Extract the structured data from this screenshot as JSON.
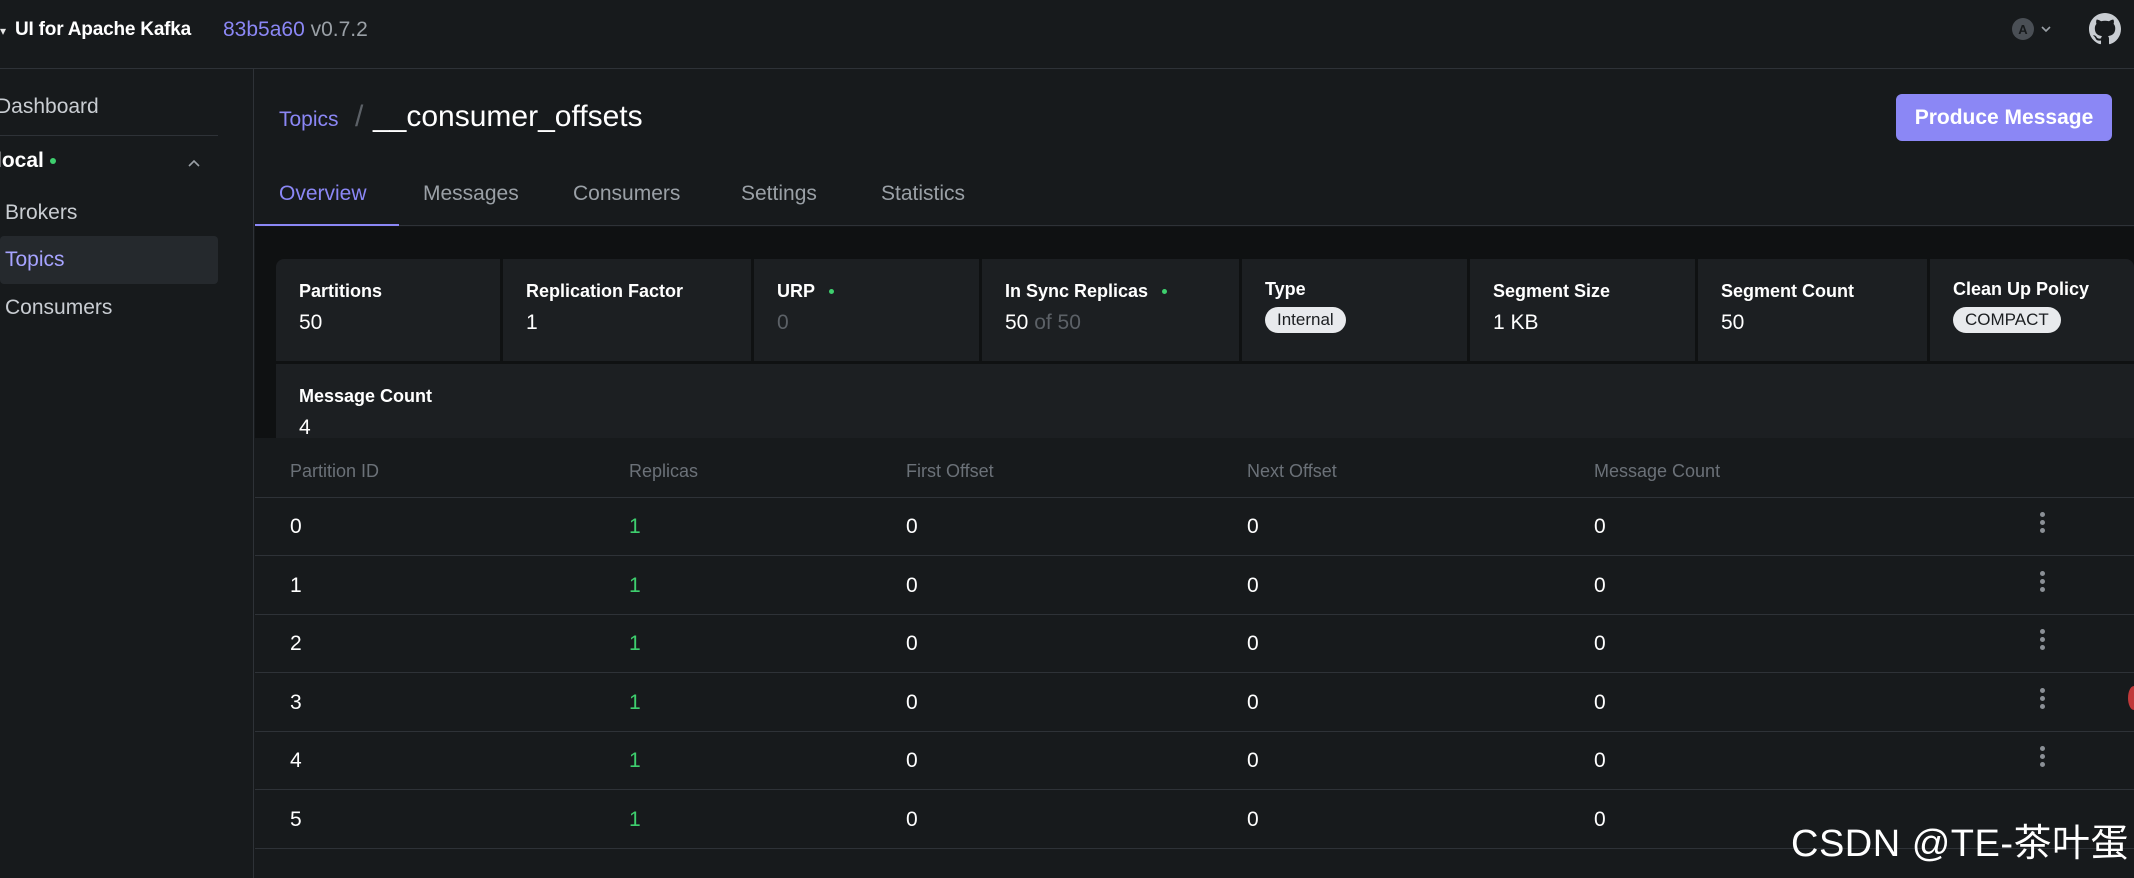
{
  "header": {
    "app_title": "UI for Apache Kafka",
    "version_hash": "83b5a60",
    "version": "v0.7.2",
    "avatar_letter": "A"
  },
  "sidebar": {
    "dashboard": "Dashboard",
    "cluster_name": "local",
    "items": [
      {
        "label": "Brokers",
        "active": false
      },
      {
        "label": "Topics",
        "active": true
      },
      {
        "label": "Consumers",
        "active": false
      }
    ]
  },
  "breadcrumb": {
    "parent": "Topics",
    "separator": "/",
    "current": "__consumer_offsets"
  },
  "produce_button": "Produce Message",
  "tabs": [
    {
      "label": "Overview",
      "active": true
    },
    {
      "label": "Messages",
      "active": false
    },
    {
      "label": "Consumers",
      "active": false
    },
    {
      "label": "Settings",
      "active": false
    },
    {
      "label": "Statistics",
      "active": false
    }
  ],
  "stats": {
    "partitions": {
      "label": "Partitions",
      "value": "50"
    },
    "replication_factor": {
      "label": "Replication Factor",
      "value": "1"
    },
    "urp": {
      "label": "URP",
      "value": "0"
    },
    "in_sync_replicas": {
      "label": "In Sync Replicas",
      "value": "50",
      "of_text": "of 50"
    },
    "type": {
      "label": "Type",
      "value": "Internal"
    },
    "segment_size": {
      "label": "Segment Size",
      "value": "1 KB"
    },
    "segment_count": {
      "label": "Segment Count",
      "value": "50"
    },
    "clean_up_policy": {
      "label": "Clean Up Policy",
      "value": "COMPACT"
    },
    "message_count": {
      "label": "Message Count",
      "value": "4"
    }
  },
  "table": {
    "columns": [
      "Partition ID",
      "Replicas",
      "First Offset",
      "Next Offset",
      "Message Count"
    ],
    "rows": [
      [
        "0",
        "1",
        "0",
        "0",
        "0"
      ],
      [
        "1",
        "1",
        "0",
        "0",
        "0"
      ],
      [
        "2",
        "1",
        "0",
        "0",
        "0"
      ],
      [
        "3",
        "1",
        "0",
        "0",
        "0"
      ],
      [
        "4",
        "1",
        "0",
        "0",
        "0"
      ],
      [
        "5",
        "1",
        "0",
        "0",
        "0"
      ]
    ]
  },
  "watermark": "CSDN @TE-茶叶蛋",
  "colors": {
    "accent": "#8b87f5",
    "success": "#3ecf6e",
    "background": "#171a1c"
  }
}
